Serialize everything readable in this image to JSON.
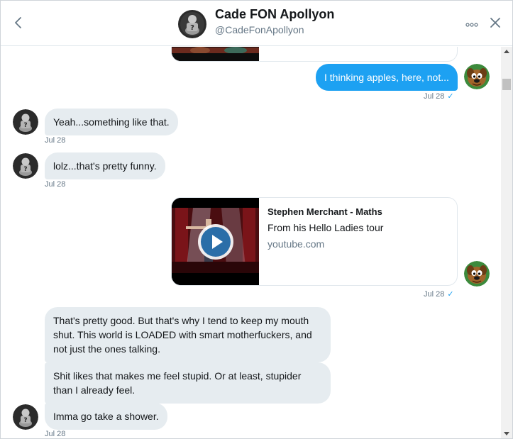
{
  "header": {
    "name": "Cade FON Apollyon",
    "handle": "@CadeFonApollyon"
  },
  "icons": {
    "back": "chevron-left-icon",
    "more": "more-dots-icon",
    "close": "close-icon"
  },
  "colors": {
    "accent": "#1da1f2",
    "incoming_bubble": "#e6ecf0",
    "secondary_text": "#657786"
  },
  "messages": {
    "m1": {
      "text": "I thinking apples, here, not...",
      "time": "Jul 28",
      "status": "✓"
    },
    "m2": {
      "text": "Yeah...something like that.",
      "time": "Jul 28"
    },
    "m3": {
      "text": "lolz...that's pretty funny.",
      "time": "Jul 28"
    },
    "card": {
      "title": "Stephen Merchant - Maths",
      "description": "From his Hello Ladies tour",
      "domain": "youtube.com",
      "time": "Jul 28",
      "status": "✓"
    },
    "m5": {
      "text": "That's pretty good. But that's why I tend to keep my mouth shut. This world is LOADED with smart motherfuckers, and not just the ones talking."
    },
    "m6": {
      "text": "Shit likes that makes me feel stupid. Or at least, stupider than I already feel."
    },
    "m7": {
      "text": "Imma go take a shower.",
      "time": "Jul 28"
    }
  }
}
